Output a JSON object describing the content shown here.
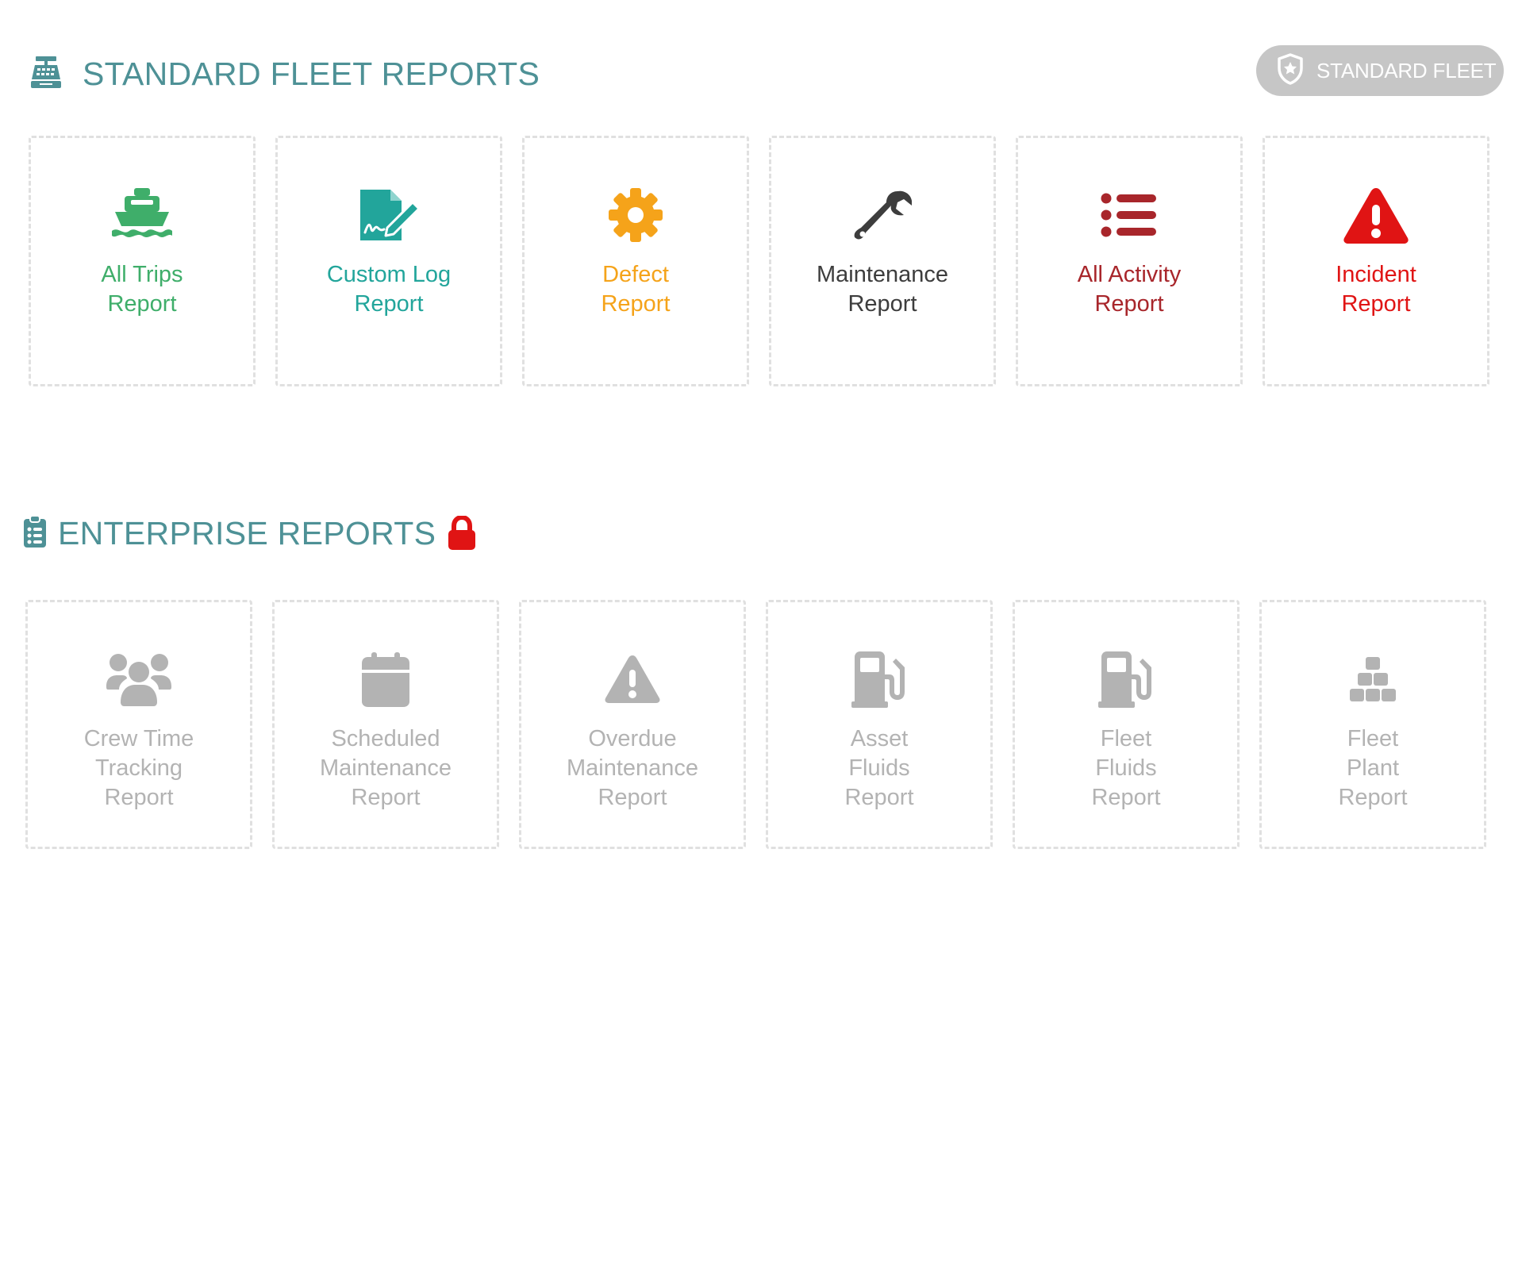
{
  "standard_section": {
    "title": "STANDARD FLEET REPORTS",
    "icon": "cash-register-icon",
    "title_color": "#4e9196"
  },
  "plan_badge": {
    "label": "STANDARD FLEET",
    "icon": "shield-star-icon",
    "background": "#c6c6c6"
  },
  "standard_reports": [
    {
      "line1": "All Trips",
      "line2": "Report",
      "icon": "ship-icon",
      "color": "#3fae6a"
    },
    {
      "line1": "Custom Log",
      "line2": "Report",
      "icon": "file-signature-icon",
      "color": "#22a59b"
    },
    {
      "line1": "Defect",
      "line2": "Report",
      "icon": "gear-icon",
      "color": "#f5a31a"
    },
    {
      "line1": "Maintenance",
      "line2": "Report",
      "icon": "wrench-icon",
      "color": "#3d3d3d"
    },
    {
      "line1": "All Activity",
      "line2": "Report",
      "icon": "list-icon",
      "color": "#a8262b"
    },
    {
      "line1": "Incident",
      "line2": "Report",
      "icon": "warning-triangle-icon",
      "color": "#e01414"
    }
  ],
  "enterprise_section": {
    "title": "ENTERPRISE REPORTS",
    "icon": "clipboard-list-icon",
    "lock_icon": "lock-icon",
    "lock_color": "#e01414"
  },
  "enterprise_reports": [
    {
      "line1": "Crew Time",
      "line2": "Tracking",
      "line3": "Report",
      "icon": "users-icon"
    },
    {
      "line1": "Scheduled",
      "line2": "Maintenance",
      "line3": "Report",
      "icon": "calendar-icon"
    },
    {
      "line1": "Overdue",
      "line2": "Maintenance",
      "line3": "Report",
      "icon": "warning-triangle-icon"
    },
    {
      "line1": "Asset",
      "line2": "Fluids",
      "line3": "Report",
      "icon": "gas-pump-icon"
    },
    {
      "line1": "Fleet",
      "line2": "Fluids",
      "line3": "Report",
      "icon": "gas-pump-icon"
    },
    {
      "line1": "Fleet",
      "line2": "Plant",
      "line3": "Report",
      "icon": "cubes-icon"
    }
  ],
  "disabled_color": "#b3b3b3"
}
